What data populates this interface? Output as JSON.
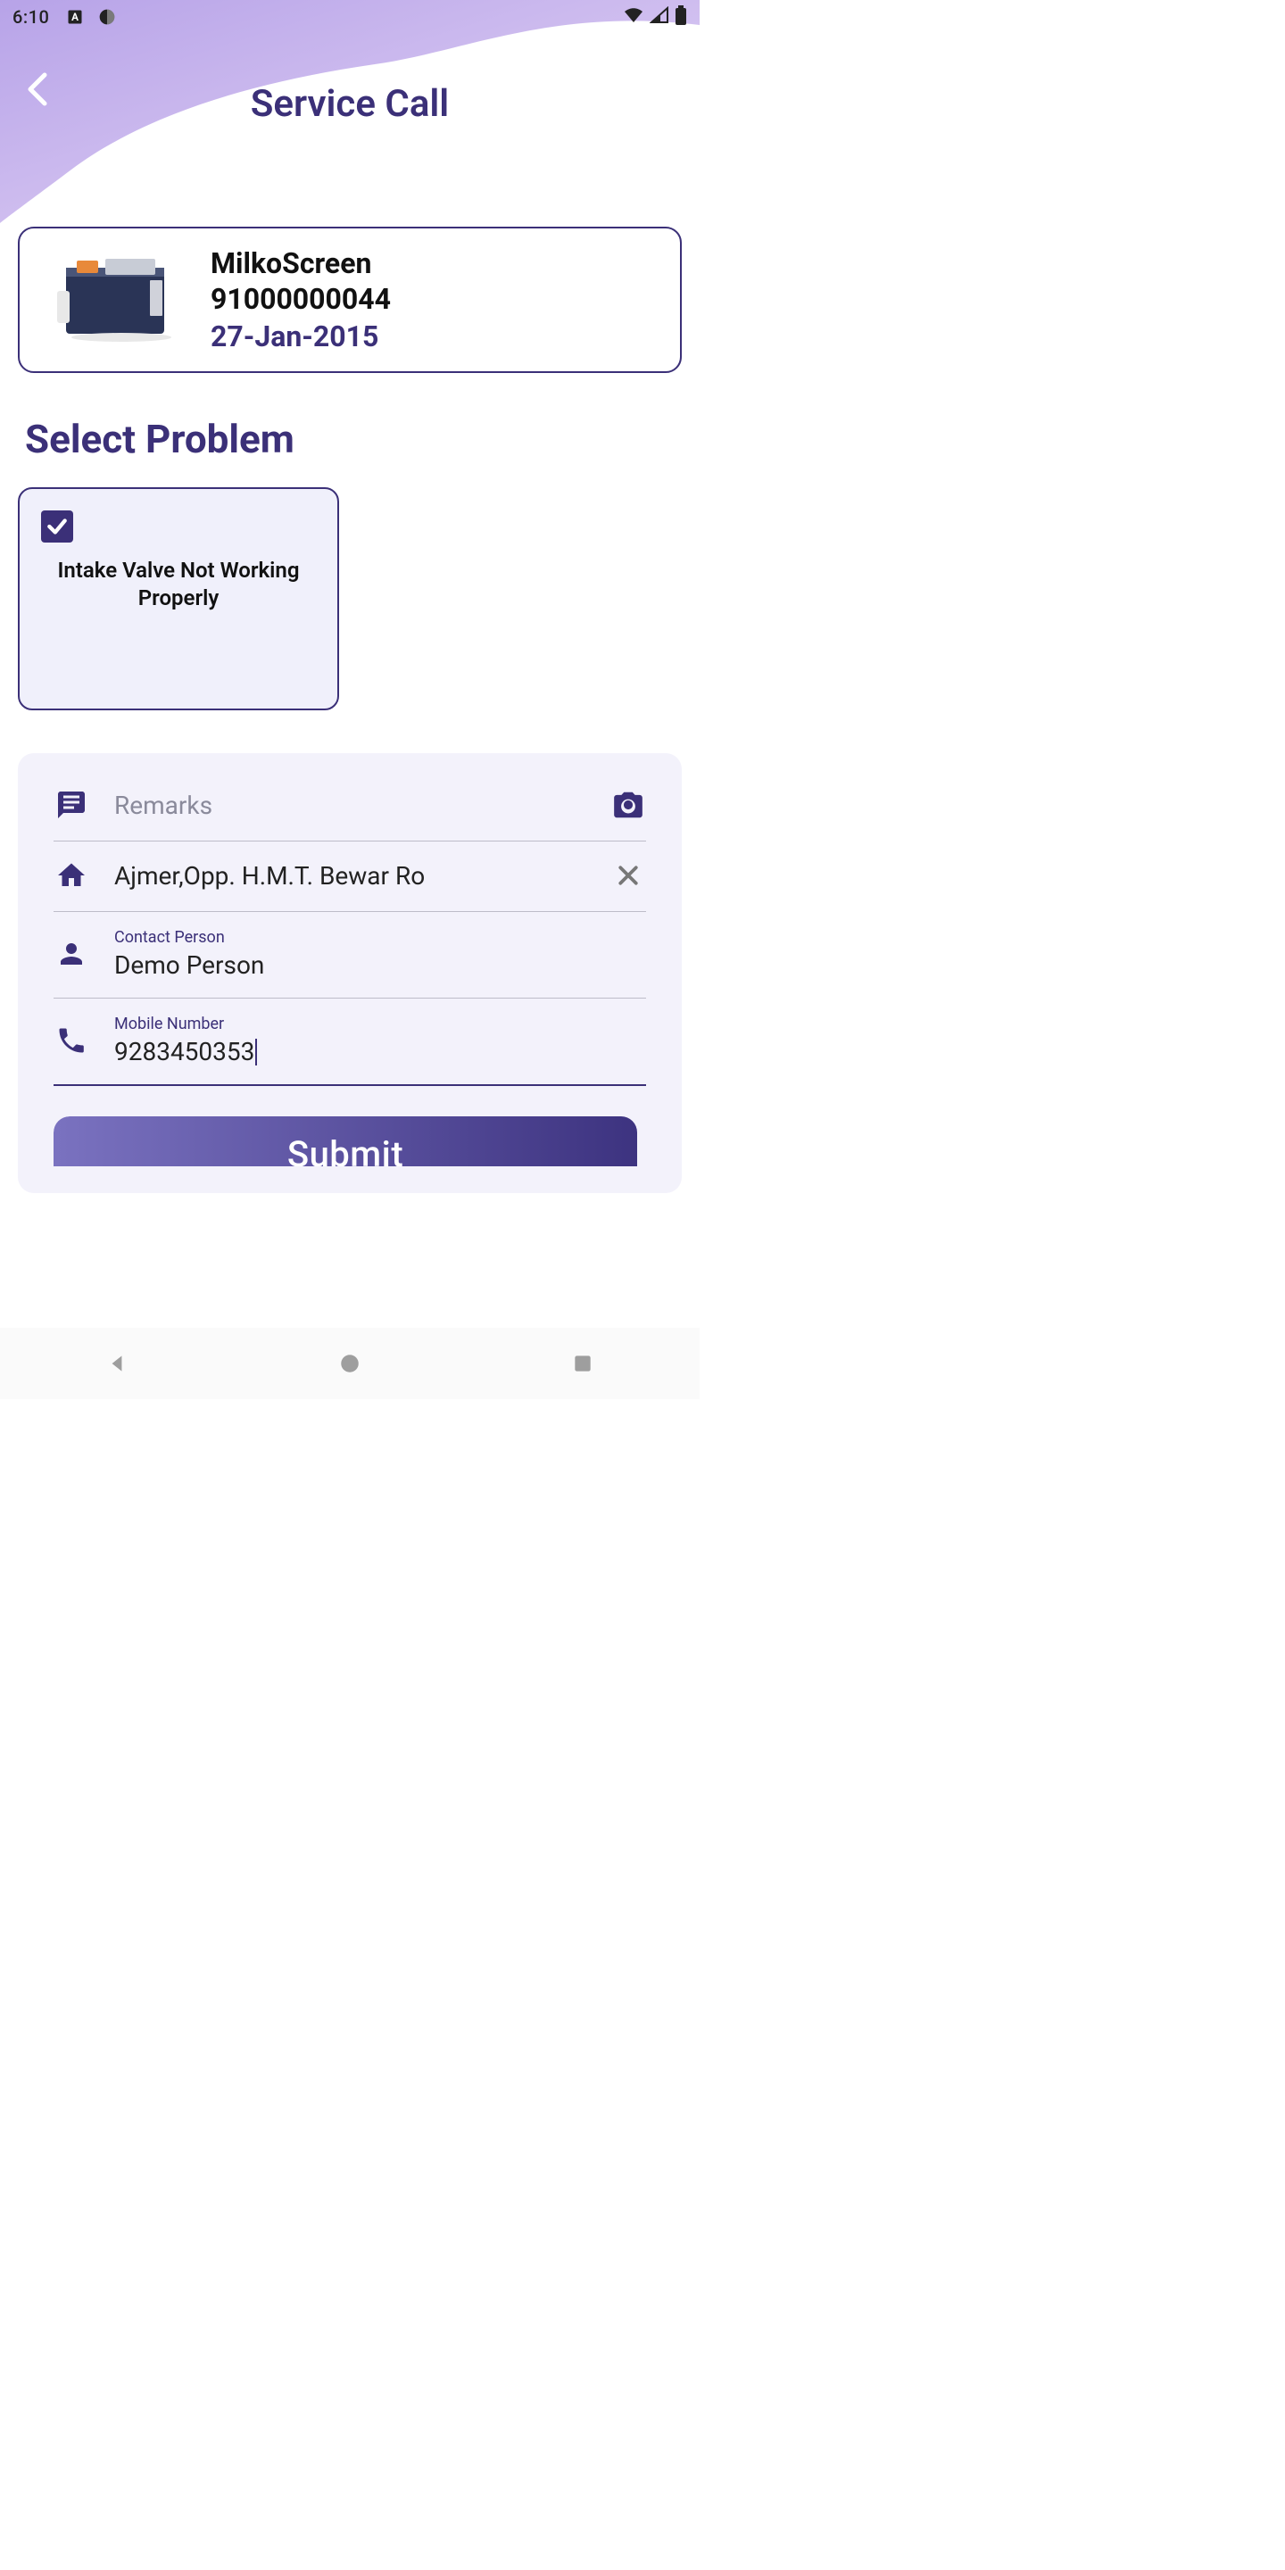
{
  "status": {
    "time": "6:10"
  },
  "header": {
    "title": "Service Call"
  },
  "device": {
    "name": "MilkoScreen",
    "serial": "91000000044",
    "date": "27-Jan-2015"
  },
  "section": {
    "heading": "Select Problem"
  },
  "problem": {
    "checked": true,
    "text": "Intake Valve Not Working Properly"
  },
  "form": {
    "remarks_placeholder": "Remarks",
    "remarks_value": "",
    "address_value": "Ajmer,Opp. H.M.T. Bewar Ro",
    "contact_label": "Contact Person",
    "contact_value": "Demo Person",
    "mobile_label": "Mobile Number",
    "mobile_value": "9283450353"
  },
  "submit": {
    "label": "Submit"
  },
  "colors": {
    "primary": "#3b3078",
    "card_bg": "#f3f2fb",
    "problem_bg": "#f0f0fb"
  }
}
